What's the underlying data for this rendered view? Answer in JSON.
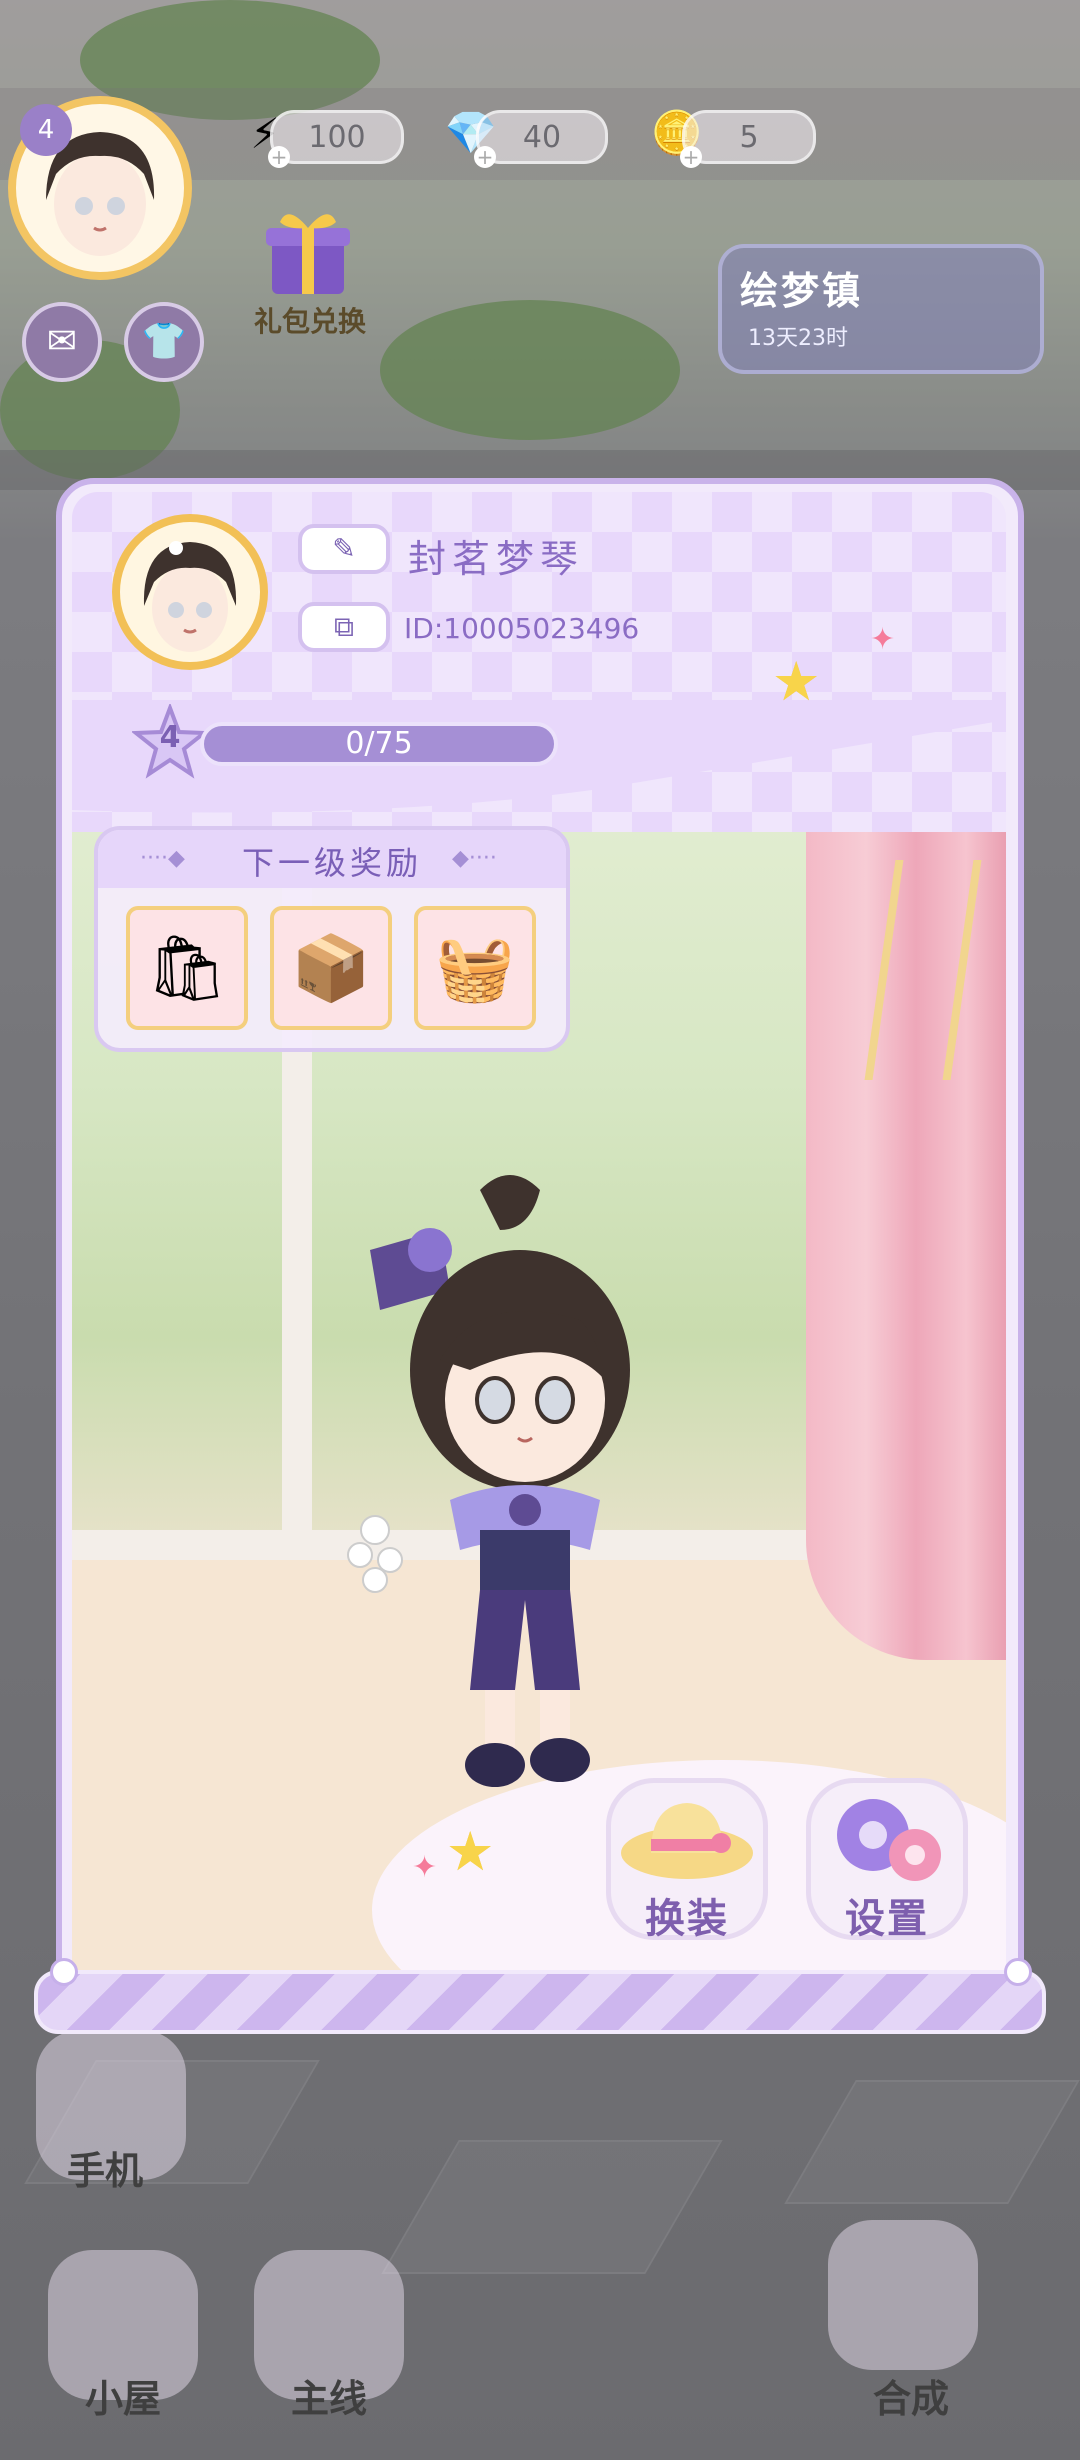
{
  "hud": {
    "level": "4",
    "energy": "100",
    "gems": "40",
    "coins": "5",
    "gift_label": "礼包兑换",
    "town_name": "绘梦镇",
    "town_time": "13天23时"
  },
  "profile": {
    "name": "封茗梦琴",
    "id": "ID:10005023496",
    "level": "4",
    "xp_text": "0/75",
    "xp_progress": 0
  },
  "reward": {
    "title": "下一级奖励",
    "items": [
      {
        "icon": "shopping-bag-icon",
        "glyph": "🛍"
      },
      {
        "icon": "cat-box-icon",
        "glyph": "📦"
      },
      {
        "icon": "fruit-basket-icon",
        "glyph": "🧺"
      }
    ]
  },
  "actions": {
    "dress_label": "换装",
    "settings_label": "设置"
  },
  "bottom_nav": {
    "phone": "手机",
    "house": "小屋",
    "main": "主线",
    "merge": "合成"
  },
  "colors": {
    "accent": "#8a6cc4",
    "panel_border": "#c9b3ea",
    "gold": "#f2c056"
  }
}
